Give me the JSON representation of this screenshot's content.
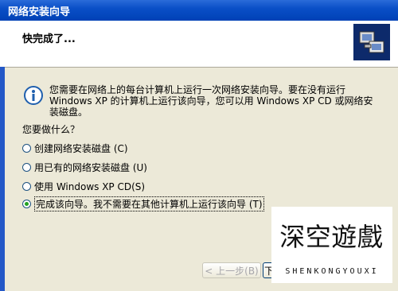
{
  "window": {
    "title": "网络安装向导"
  },
  "header": {
    "title": "快完成了..."
  },
  "body": {
    "description": "您需要在网络上的每台计算机上运行一次网络安装向导。要在没有运行 Windows XP 的计算机上运行该向导，您可以用 Windows XP CD 或网络安装磁盘。",
    "question": "您要做什么？",
    "options": [
      {
        "label": "创建网络安装磁盘 (C)",
        "selected": false
      },
      {
        "label": "用已有的网络安装磁盘 (U)",
        "selected": false
      },
      {
        "label": "使用 Windows XP CD(S)",
        "selected": false
      },
      {
        "label": "完成该向导。我不需要在其他计算机上运行该向导 (T)",
        "selected": true
      }
    ]
  },
  "buttons": {
    "back": "< 上一步(B)",
    "next": "下"
  },
  "watermark": {
    "chars": [
      "深",
      "空",
      "遊",
      "戲"
    ],
    "subtitle": "SHENKONGYOUXI"
  },
  "icons": {
    "info": "info-icon",
    "wizard": "network-computers-icon"
  },
  "colors": {
    "titlebar": "#0a4fc7",
    "dialog": "#ece9d8",
    "radio_selected": "#21a121"
  }
}
